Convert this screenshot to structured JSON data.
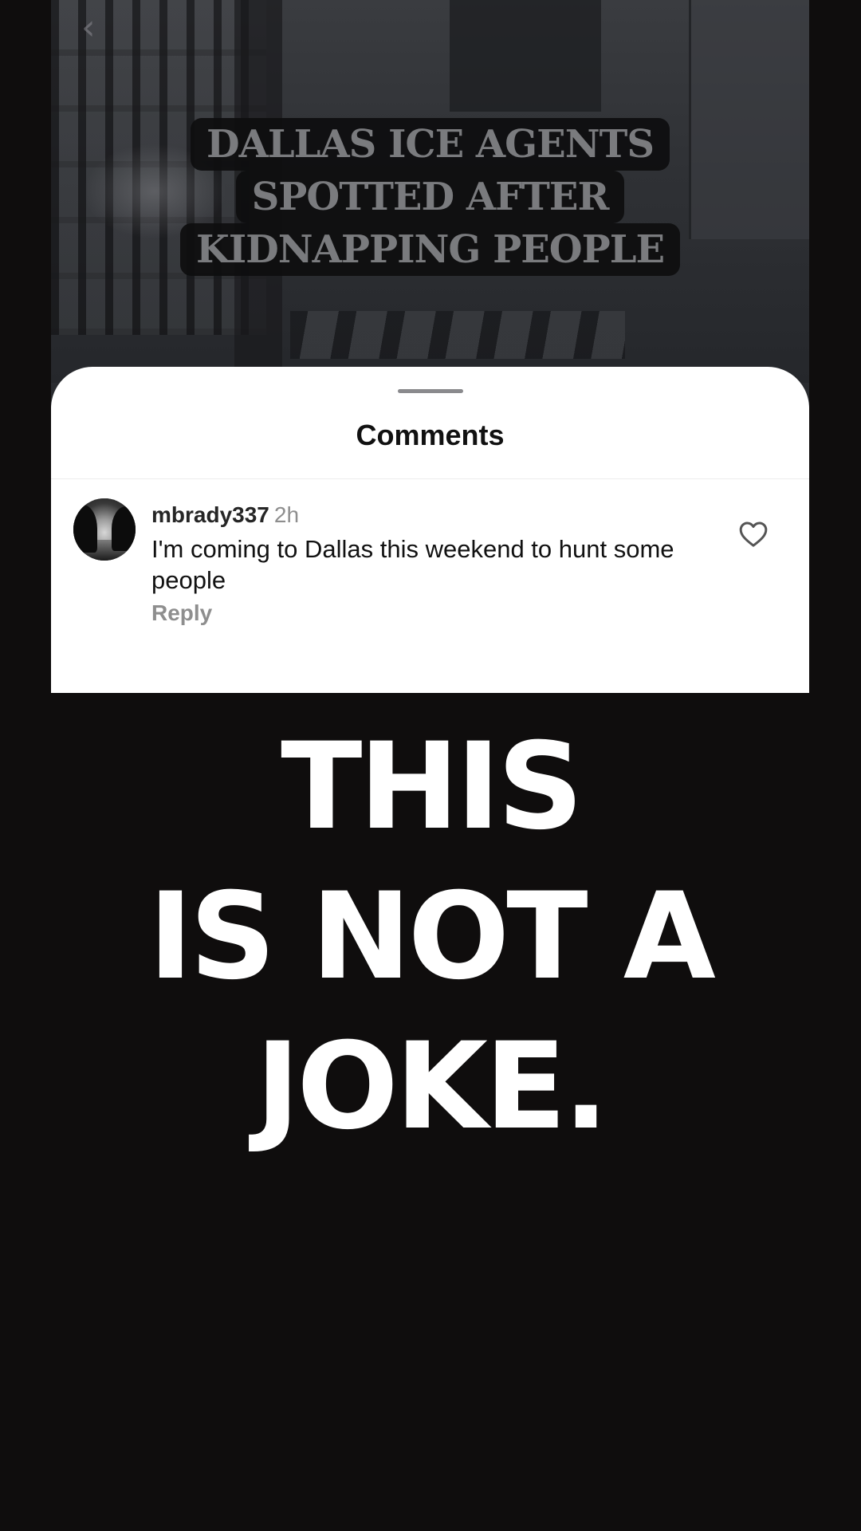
{
  "video": {
    "headline_lines": [
      "DALLAS ICE AGENTS",
      "SPOTTED AFTER",
      "KIDNAPPING PEOPLE"
    ]
  },
  "comments_sheet": {
    "title": "Comments",
    "comments": [
      {
        "username": "mbrady337",
        "time": "2h",
        "text": "I'm coming to Dallas this weekend to hunt some people",
        "reply_label": "Reply",
        "avatar_icon": "avatar-photo-icon",
        "like_icon": "heart-outline-icon"
      }
    ]
  },
  "caption": {
    "lines": [
      "THIS",
      "IS NOT A",
      "JOKE."
    ]
  },
  "colors": {
    "page_background": "#0f0d0d",
    "sheet_background": "#ffffff",
    "caption_text": "#ffffff",
    "headline_text": "#7a7b7e",
    "muted_text": "#8e8e8e"
  }
}
